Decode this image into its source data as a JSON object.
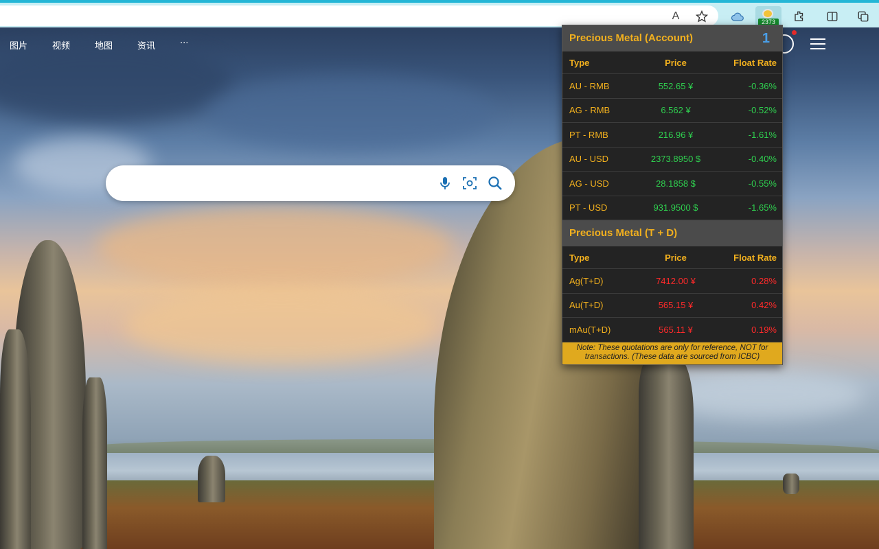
{
  "nav": {
    "items": [
      "图片",
      "视频",
      "地图",
      "资讯"
    ],
    "more": "···"
  },
  "toolbar": {
    "icons": [
      "read-aloud-icon",
      "favorite-star-icon",
      "cloud-extension-icon",
      "gold-price-extension-icon",
      "extensions-icon",
      "split-screen-icon",
      "collections-icon"
    ],
    "extension_badge": "2373",
    "read_aloud_label": "A"
  },
  "search": {
    "placeholder": "",
    "icons": [
      "microphone-icon",
      "visual-search-icon",
      "search-icon"
    ]
  },
  "popup": {
    "account": {
      "title": "Precious Metal (Account)",
      "page_number": "1",
      "headers": [
        "Type",
        "Price",
        "Float Rate"
      ],
      "rows": [
        {
          "type": "AU - RMB",
          "price": "552.65 ¥",
          "rate": "-0.36%"
        },
        {
          "type": "AG - RMB",
          "price": "6.562 ¥",
          "rate": "-0.52%"
        },
        {
          "type": "PT - RMB",
          "price": "216.96 ¥",
          "rate": "-1.61%"
        },
        {
          "type": "AU - USD",
          "price": "2373.8950 $",
          "rate": "-0.40%"
        },
        {
          "type": "AG - USD",
          "price": "28.1858 $",
          "rate": "-0.55%"
        },
        {
          "type": "PT - USD",
          "price": "931.9500 $",
          "rate": "-1.65%"
        }
      ]
    },
    "td": {
      "title": "Precious Metal (T + D)",
      "headers": [
        "Type",
        "Price",
        "Float Rate"
      ],
      "rows": [
        {
          "type": "Ag(T+D)",
          "price": "7412.00 ¥",
          "rate": "0.28%"
        },
        {
          "type": "Au(T+D)",
          "price": "565.15 ¥",
          "rate": "0.42%"
        },
        {
          "type": "mAu(T+D)",
          "price": "565.11 ¥",
          "rate": "0.19%"
        }
      ]
    },
    "note": "Note: These quotations are only for reference, NOT for transactions. (These data are sourced from ICBC)"
  },
  "colors": {
    "accent": "#f2b01e",
    "down": "#2fcf4f",
    "up": "#ff2a2a",
    "page_number": "#4a9fe8"
  }
}
